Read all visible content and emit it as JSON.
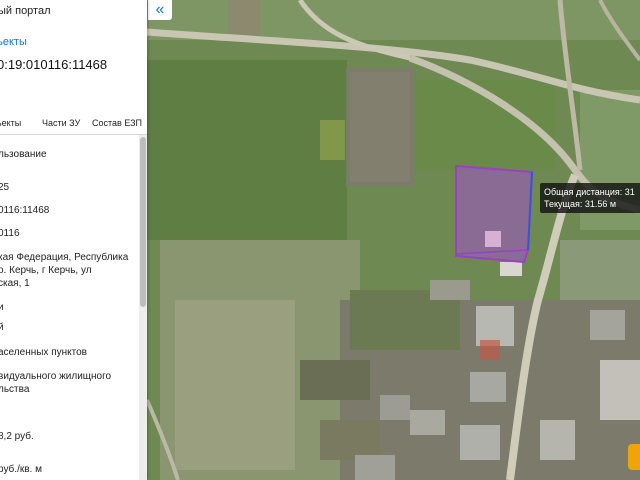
{
  "panel": {
    "portal_title": "ый портал",
    "objects_link": "ъекты",
    "cadastral_number": "0:19:010116:11468",
    "tabs": [
      "ъекты",
      "Части ЗУ",
      "Состав ЕЗП"
    ],
    "info_lines": [
      "льзование",
      "25",
      "0116:11468",
      "0116",
      "кая Федерация, Республика",
      "о. Керчь, г Керчь, ул",
      "ская, 1",
      "и",
      "й",
      "аселенных пунктов",
      "видуального жилищного",
      "льства",
      "8,2 руб.",
      "руб./кв. м"
    ]
  },
  "map": {
    "collapse_glyph": "«",
    "measure_tooltip": {
      "total_distance": "Общая дистанция: 31",
      "current": "Текущая: 31.56 м"
    },
    "parcel_color": "#9b3fc7"
  },
  "colors": {
    "link": "#1a73c9",
    "tooltip_bg": "#141414"
  }
}
